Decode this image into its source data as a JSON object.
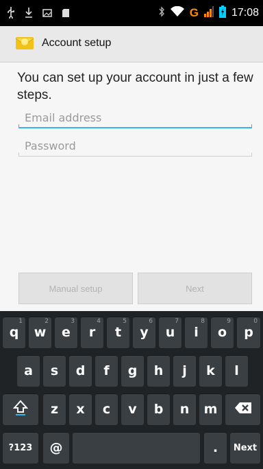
{
  "status_bar": {
    "time": "17:08",
    "network": "G"
  },
  "titlebar": {
    "title": "Account setup"
  },
  "setup": {
    "intro": "You can set up your account in just a few steps.",
    "email_placeholder": "Email address",
    "password_placeholder": "Password",
    "manual_setup_label": "Manual setup",
    "next_label": "Next"
  },
  "keyboard": {
    "row1": [
      {
        "label": "q",
        "hint": "1"
      },
      {
        "label": "w",
        "hint": "2"
      },
      {
        "label": "e",
        "hint": "3"
      },
      {
        "label": "r",
        "hint": "4"
      },
      {
        "label": "t",
        "hint": "5"
      },
      {
        "label": "y",
        "hint": "6"
      },
      {
        "label": "u",
        "hint": "7"
      },
      {
        "label": "i",
        "hint": "8"
      },
      {
        "label": "o",
        "hint": "9"
      },
      {
        "label": "p",
        "hint": "0"
      }
    ],
    "row2": [
      "a",
      "s",
      "d",
      "f",
      "g",
      "h",
      "j",
      "k",
      "l"
    ],
    "row3": [
      "z",
      "x",
      "c",
      "v",
      "b",
      "n",
      "m"
    ],
    "symbols_label": "?123",
    "at_label": "@",
    "period_label": ".",
    "next_label": "Next",
    "shift_icon": "shift-icon",
    "backspace_icon": "backspace-icon"
  },
  "colors": {
    "accent": "#33b5e5",
    "network": "#ff8a00",
    "battery": "#00d0ff"
  }
}
